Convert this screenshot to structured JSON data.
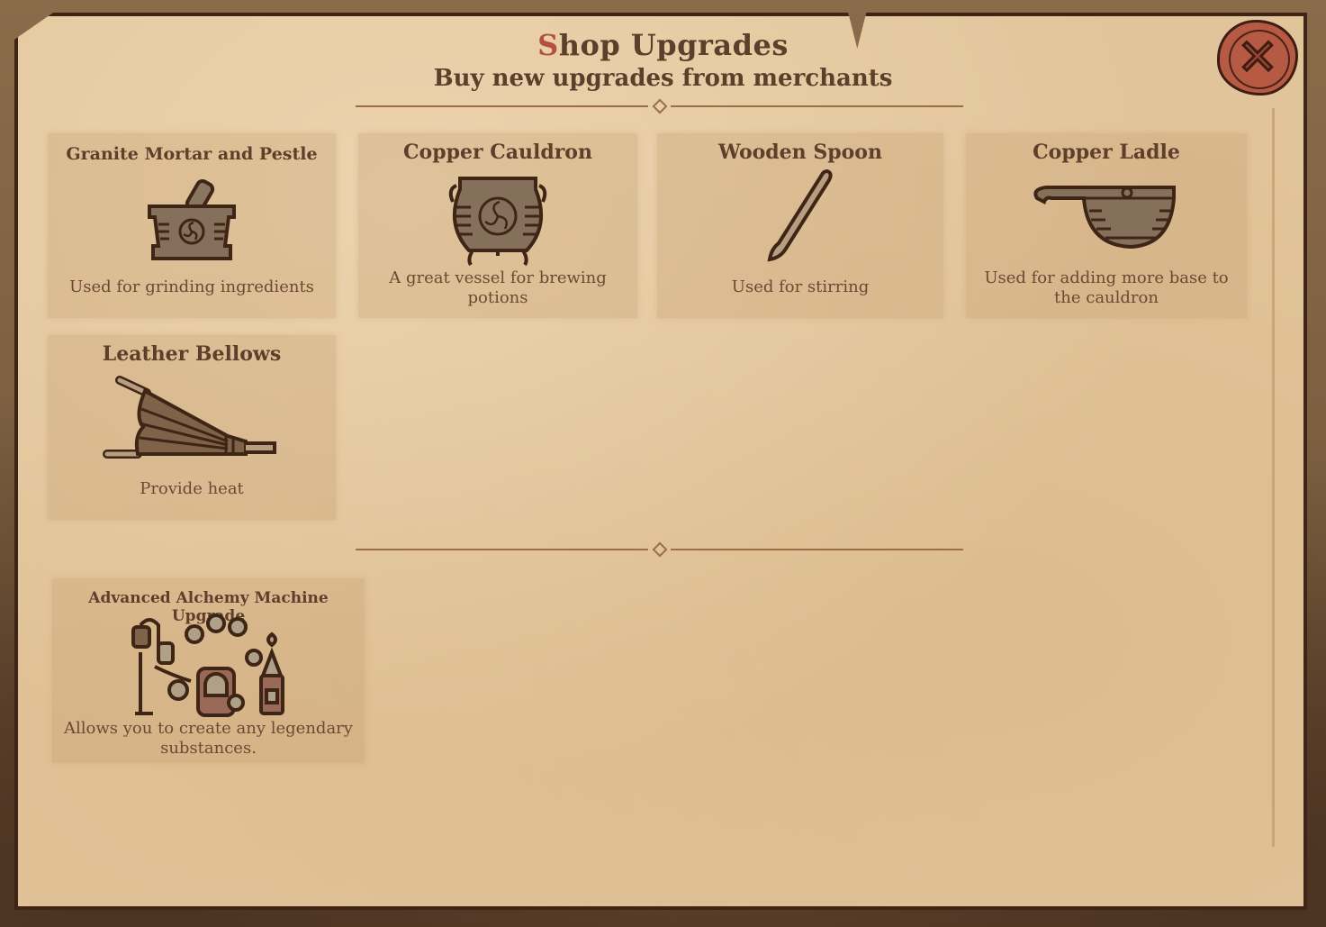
{
  "header": {
    "title_first_letter": "S",
    "title_rest": "hop Upgrades",
    "subtitle": "Buy new upgrades from merchants"
  },
  "close_button": {
    "label": "close",
    "icon": "wax-seal-x-icon"
  },
  "colors": {
    "parchment": "#e2c49a",
    "text": "#5e3f2b",
    "accent_red": "#b4503c",
    "seal": "#b65a44",
    "divider": "#9b6e45"
  },
  "sections": [
    {
      "items": [
        {
          "name": "Granite Mortar and Pestle",
          "description": "Used for grinding ingredients",
          "icon": "mortar-pestle-icon"
        },
        {
          "name": "Copper Cauldron",
          "description": "A great vessel for brewing potions",
          "icon": "cauldron-icon"
        },
        {
          "name": "Wooden Spoon",
          "description": "Used for stirring",
          "icon": "wooden-spoon-icon"
        },
        {
          "name": "Copper Ladle",
          "description": "Used for adding more base to the cauldron",
          "icon": "ladle-icon"
        },
        {
          "name": "Leather Bellows",
          "description": "Provide heat",
          "icon": "bellows-icon"
        }
      ]
    },
    {
      "items": [
        {
          "name": "Advanced Alchemy Machine Upgrade",
          "description": "Allows you to create any legendary substances.",
          "icon": "alchemy-machine-icon"
        }
      ]
    }
  ]
}
